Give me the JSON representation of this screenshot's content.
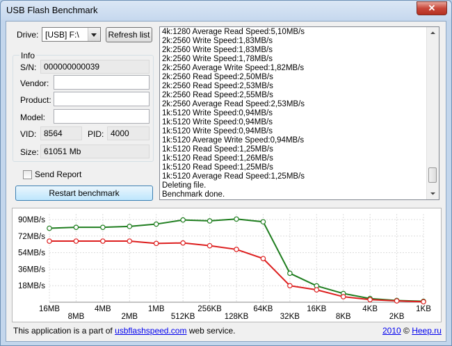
{
  "window": {
    "title": "USB Flash Benchmark",
    "close_glyph": "✕"
  },
  "drive": {
    "label": "Drive:",
    "selected": "[USB] F:\\",
    "refresh_label": "Refresh list"
  },
  "info": {
    "group_label": "Info",
    "sn_label": "S/N:",
    "sn_value": "000000000039",
    "vendor_label": "Vendor:",
    "vendor_value": "",
    "product_label": "Product:",
    "product_value": "",
    "model_label": "Model:",
    "model_value": "",
    "vid_label": "VID:",
    "vid_value": "8564",
    "pid_label": "PID:",
    "pid_value": "4000",
    "size_label": "Size:",
    "size_value": "61051 Mb"
  },
  "send_report_label": "Send Report",
  "restart_label": "Restart benchmark",
  "log_lines": [
    "4k:1280 Average Read Speed:5,10MB/s",
    "2k:2560 Write Speed:1,83MB/s",
    "2k:2560 Write Speed:1,83MB/s",
    "2k:2560 Write Speed:1,78MB/s",
    "2k:2560 Average Write Speed:1,82MB/s",
    "2k:2560 Read Speed:2,50MB/s",
    "2k:2560 Read Speed:2,53MB/s",
    "2k:2560 Read Speed:2,55MB/s",
    "2k:2560 Average Read Speed:2,53MB/s",
    "1k:5120 Write Speed:0,94MB/s",
    "1k:5120 Write Speed:0,94MB/s",
    "1k:5120 Write Speed:0,94MB/s",
    "1k:5120 Average Write Speed:0,94MB/s",
    "1k:5120 Read Speed:1,25MB/s",
    "1k:5120 Read Speed:1,26MB/s",
    "1k:5120 Read Speed:1,25MB/s",
    "1k:5120 Average Read Speed:1,25MB/s",
    "Deleting file.",
    "Benchmark done."
  ],
  "chart_data": {
    "type": "line",
    "categories": [
      "16MB",
      "8MB",
      "4MB",
      "2MB",
      "1MB",
      "512KB",
      "256KB",
      "128KB",
      "64KB",
      "32KB",
      "16KB",
      "8KB",
      "4KB",
      "2KB",
      "1KB"
    ],
    "yticks": [
      "90MB/s",
      "72MB/s",
      "54MB/s",
      "36MB/s",
      "18MB/s"
    ],
    "ytick_values": [
      90,
      72,
      54,
      36,
      18
    ],
    "ylim": [
      0,
      96
    ],
    "grid": true,
    "series": [
      {
        "color": "#1e7d1e",
        "values": [
          80.5,
          81.5,
          81.5,
          82.5,
          85,
          89.5,
          88.5,
          90.5,
          87.5,
          31.5,
          17.8,
          9.5,
          4.0,
          1.9,
          1.0
        ]
      },
      {
        "color": "#dd1e1e",
        "values": [
          66.5,
          66.5,
          66.5,
          66.5,
          64.0,
          64.5,
          61.5,
          57.5,
          47.5,
          18.0,
          13.5,
          6.0,
          2.8,
          1.5,
          0.5
        ]
      }
    ]
  },
  "footer": {
    "text_before": "This application is a part of ",
    "link_text": "usbflashspeed.com",
    "text_after": " web service.",
    "credit_year": "2010",
    "credit_sep": " © ",
    "credit_link": "Heep.ru"
  }
}
